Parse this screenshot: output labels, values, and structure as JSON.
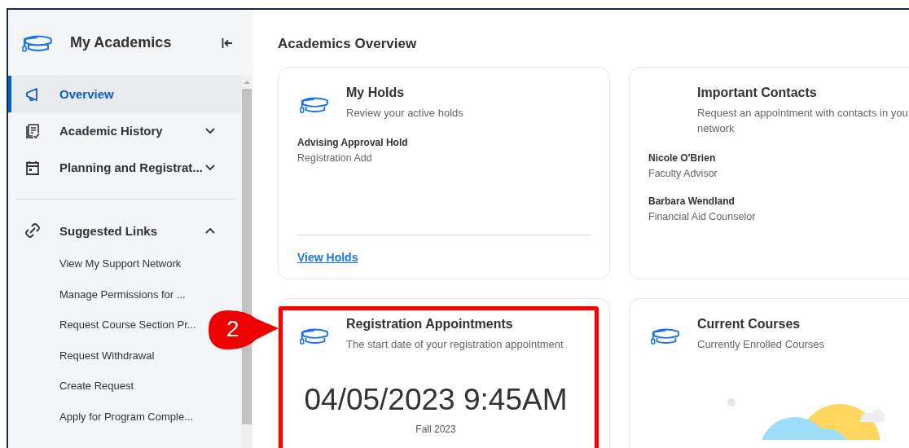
{
  "sidebar": {
    "title": "My Academics",
    "nav": [
      {
        "label": "Overview",
        "selected": true
      },
      {
        "label": "Academic History",
        "selected": false,
        "expanded": false
      },
      {
        "label": "Planning and Registrat...",
        "selected": false,
        "expanded": false
      }
    ],
    "section": {
      "label": "Suggested Links",
      "expanded": true,
      "links": [
        "View My Support Network",
        "Manage Permissions for ...",
        "Request Course Section Pr...",
        "Request Withdrawal",
        "Create Request",
        "Apply for Program Comple..."
      ]
    }
  },
  "main": {
    "title": "Academics Overview",
    "cards": [
      {
        "kind": "list",
        "icon": true,
        "title": "My Holds",
        "subtitle": "Review your active holds",
        "items": [
          {
            "name": "Advising Approval Hold",
            "detail": "Registration Add"
          }
        ],
        "link": "View Holds"
      },
      {
        "kind": "list",
        "icon": false,
        "title": "Important Contacts",
        "subtitle": "Request an appointment with contacts in you network",
        "items": [
          {
            "name": "Nicole O'Brien",
            "detail": "Faculty Advisor"
          },
          {
            "name": "Barbara Wendland",
            "detail": "Financial Aid Counselor"
          }
        ]
      },
      {
        "kind": "date",
        "icon": true,
        "title": "Registration Appointments",
        "subtitle": "The start date of your registration appointment",
        "date": "04/05/2023 9:45AM",
        "term": "Fall 2023",
        "annotation": "2"
      },
      {
        "kind": "empty",
        "icon": true,
        "title": "Current Courses",
        "subtitle": "Currently Enrolled Courses"
      }
    ]
  }
}
